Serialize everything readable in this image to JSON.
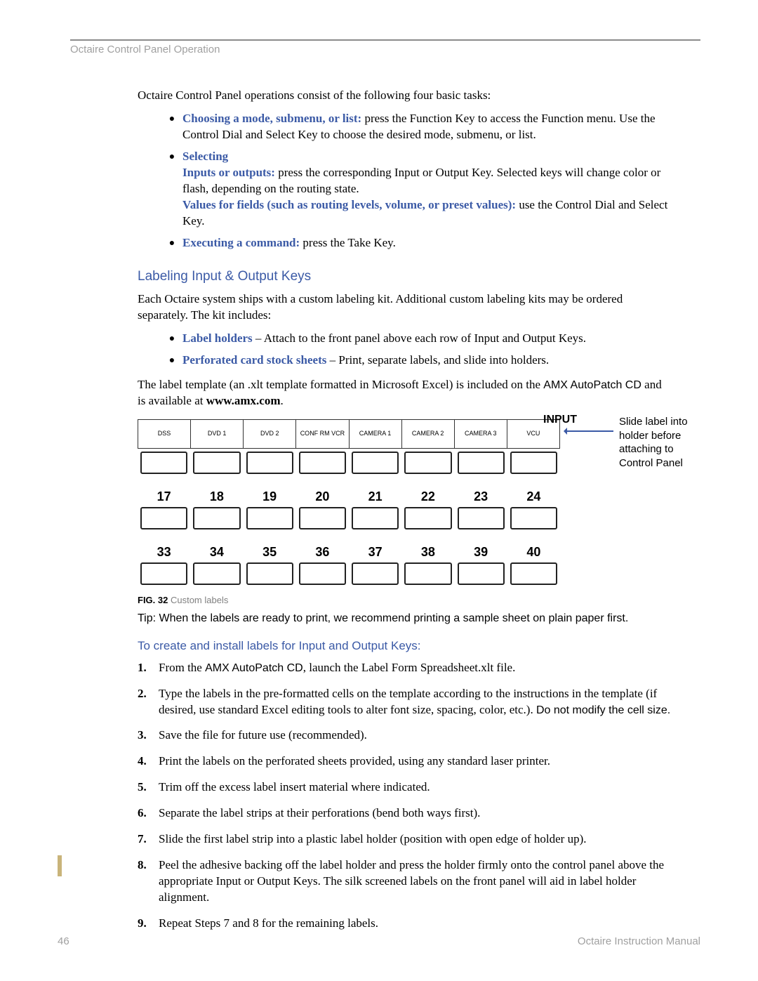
{
  "header": "Octaire Control Panel Operation",
  "intro": "Octaire Control Panel operations consist of the following four basic tasks:",
  "bullets": {
    "b1_strong": "Choosing a mode, submenu, or list:",
    "b1_rest": " press the Function Key to access the Function menu. Use the Control Dial and Select Key to choose the desired mode, submenu, or list.",
    "b2_head": "Selecting",
    "b2_io_strong": "Inputs or outputs:",
    "b2_io_rest": " press the corresponding Input or Output Key. Selected keys will change color or flash, depending on the routing state.",
    "b2_val_strong": "Values for fields (such as routing levels, volume, or preset values):",
    "b2_val_rest": " use the Control Dial and Select Key.",
    "b3_strong": "Executing a command:",
    "b3_rest": " press the Take Key."
  },
  "h2": "Labeling Input & Output Keys",
  "p2": "Each Octaire system ships with a custom labeling kit. Additional custom labeling kits may be ordered separately. The kit includes:",
  "kit": {
    "k1_strong": "Label holders",
    "k1_rest": " – Attach to the front panel above each row of Input and Output Keys.",
    "k2_strong": "Perforated card stock sheets",
    "k2_rest": " – Print, separate labels, and slide into holders."
  },
  "p3a": "The label template (an .xlt template formatted in Microsoft Excel) is included on the ",
  "p3b": "AMX AutoPatch CD",
  "p3c": " and is available at ",
  "p3d": "www.amx.com",
  "p3e": ".",
  "diagram": {
    "input_tag": "INPUT",
    "annot": "Slide label into holder before attaching to Control Panel",
    "row1": [
      "DSS",
      "DVD  1",
      "DVD  2",
      "CONF RM VCR",
      "CAMERA  1",
      "CAMERA  2",
      "CAMERA  3",
      "VCU"
    ],
    "row2": [
      "17",
      "18",
      "19",
      "20",
      "21",
      "22",
      "23",
      "24"
    ],
    "row3": [
      "33",
      "34",
      "35",
      "36",
      "37",
      "38",
      "39",
      "40"
    ]
  },
  "figcap": {
    "num": "FIG. 32",
    "text": "  Custom labels"
  },
  "tip": "Tip:  When the labels are ready to print, we recommend printing a sample sheet on plain paper first.",
  "h3": "To create and install labels for Input and Output Keys:",
  "steps": {
    "s1a": "From the ",
    "s1b": "AMX AutoPatch CD",
    "s1c": ", launch the Label Form Spreadsheet.xlt file.",
    "s2a": "Type the labels in the pre-formatted cells on the template according to the instructions in the template (if desired, use standard Excel editing tools to alter font size, spacing, color, etc.). ",
    "s2b": "Do not modify the cell size.",
    "s3": "Save the file for future use (recommended).",
    "s4": "Print the labels on the perforated sheets provided, using any standard laser printer.",
    "s5": "Trim off the excess label insert material where indicated.",
    "s6": "Separate the label strips at their perforations (bend both ways first).",
    "s7": "Slide the first label strip into a plastic label holder (position with open edge of holder up).",
    "s8": "Peel the adhesive backing off the label holder and press the holder firmly onto the control panel above the appropriate Input or Output Keys. The silk screened labels on the front panel will aid in label holder alignment.",
    "s9": "Repeat Steps 7 and 8 for the remaining labels."
  },
  "footer": {
    "page": "46",
    "title": "Octaire Instruction Manual"
  }
}
